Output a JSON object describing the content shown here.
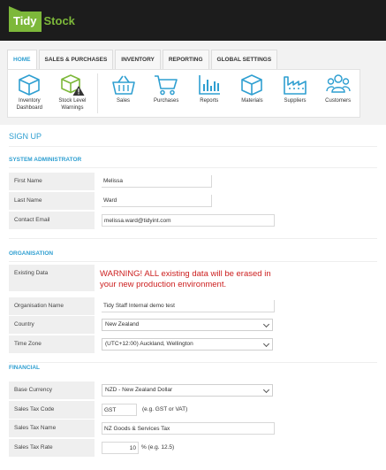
{
  "app": {
    "logo_left": "Tidy",
    "logo_right": "Stock",
    "brand_color": "#7db83a",
    "accent_color": "#2f9fd1",
    "warning_color": "#cc1f1f"
  },
  "tabs": [
    {
      "label": "HOME",
      "active": true
    },
    {
      "label": "SALES & PURCHASES",
      "active": false
    },
    {
      "label": "INVENTORY",
      "active": false
    },
    {
      "label": "REPORTING",
      "active": false
    },
    {
      "label": "GLOBAL SETTINGS",
      "active": false
    }
  ],
  "ribbon": [
    {
      "label": "Inventory Dashboard",
      "icon": "cube-icon"
    },
    {
      "label": "Stock Level Warnings",
      "icon": "cube-warning-icon"
    },
    {
      "label": "Sales",
      "icon": "basket-icon"
    },
    {
      "label": "Purchases",
      "icon": "cart-icon"
    },
    {
      "label": "Reports",
      "icon": "bar-chart-icon"
    },
    {
      "label": "Materials",
      "icon": "cube-icon"
    },
    {
      "label": "Suppliers",
      "icon": "factory-icon"
    },
    {
      "label": "Customers",
      "icon": "people-icon"
    }
  ],
  "page_title": "SIGN UP",
  "sections": {
    "admin": "SYSTEM ADMINISTRATOR",
    "organisation": "ORGANISATION",
    "financial": "FINANCIAL"
  },
  "admin": {
    "first_name": {
      "label": "First Name",
      "value": "Melissa"
    },
    "last_name": {
      "label": "Last Name",
      "value": "Ward"
    },
    "email": {
      "label": "Contact Email",
      "value": "melissa.ward@tidyint.com"
    }
  },
  "organisation": {
    "existing": {
      "label": "Existing Data",
      "warning": "WARNING! ALL existing data will be erased in your new production environment."
    },
    "name": {
      "label": "Organisation Name",
      "value": "Tidy Staff Internal demo test"
    },
    "country": {
      "label": "Country",
      "value": "New Zealand"
    },
    "timezone": {
      "label": "Time Zone",
      "value": "(UTC+12:00) Auckland, Wellington"
    }
  },
  "financial": {
    "currency": {
      "label": "Base Currency",
      "value": "NZD - New Zealand Dollar"
    },
    "tax_code": {
      "label": "Sales Tax Code",
      "value": "GST",
      "hint": "(e.g. GST or VAT)"
    },
    "tax_name": {
      "label": "Sales Tax Name",
      "value": "NZ Goods & Services Tax"
    },
    "tax_rate": {
      "label": "Sales Tax Rate",
      "value": "10",
      "hint": "% (e.g. 12.5)"
    }
  }
}
